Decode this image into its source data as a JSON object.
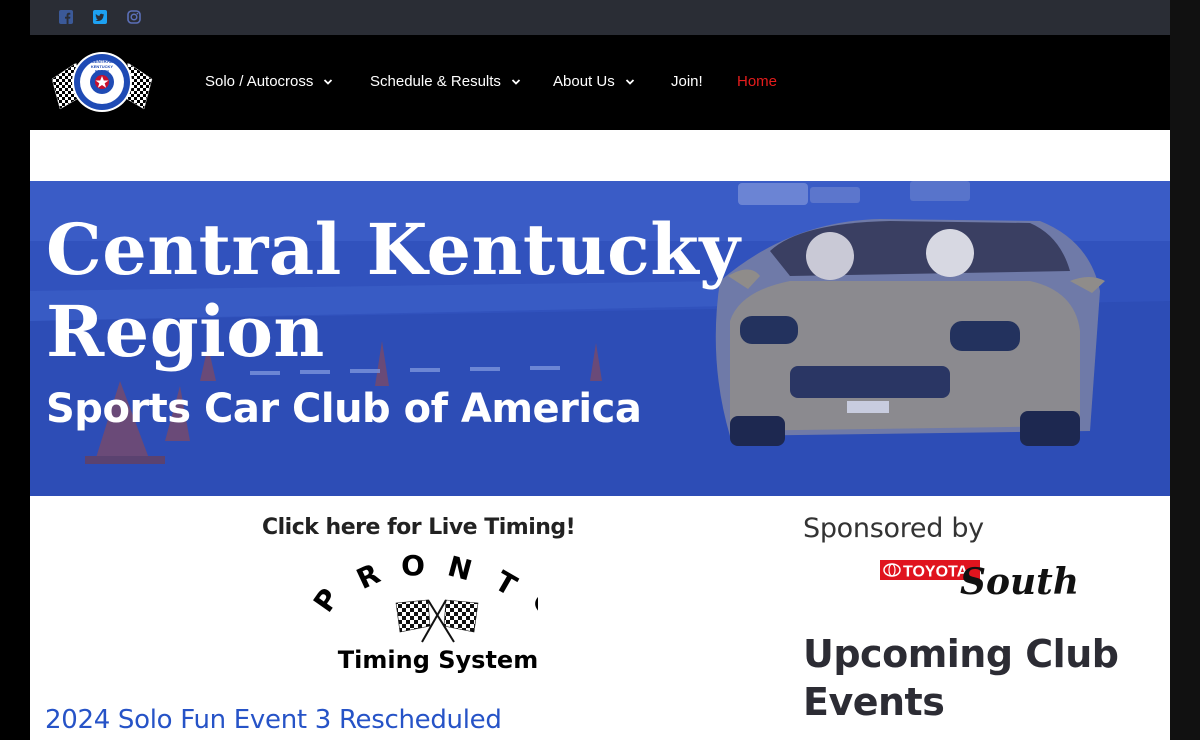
{
  "social": [
    {
      "icon": "facebook-icon",
      "color": "#3b5998"
    },
    {
      "icon": "twitter-icon",
      "color": "#1da1f2"
    },
    {
      "icon": "instagram-icon",
      "color": "#5b6fb8"
    }
  ],
  "logo": {
    "top_text": "CENTRAL KENTUCKY REGION"
  },
  "nav": {
    "items": [
      {
        "label": "Solo / Autocross",
        "has_dropdown": true
      },
      {
        "label": "Schedule & Results",
        "has_dropdown": true
      },
      {
        "label": "About Us",
        "has_dropdown": true
      },
      {
        "label": "Join!",
        "has_dropdown": false
      },
      {
        "label": "Home",
        "active": true
      }
    ],
    "active_color": "#e51c1c"
  },
  "hero": {
    "title_line1": "Central Kentucky",
    "title_line2": "Region",
    "subtitle": "Sports Car Club of America",
    "overlay_color": "#3355c0"
  },
  "main": {
    "live_timing": "Click here for Live Timing!",
    "pronto_letters": "PRONTO",
    "pronto_caption": "Timing System",
    "post_title": "2024 Solo Fun Event 3 Rescheduled"
  },
  "sidebar": {
    "sponsored_label": "Sponsored by",
    "sponsor_brand": "TOYOTA",
    "sponsor_script": "South",
    "upcoming_heading": "Upcoming Club Events"
  }
}
